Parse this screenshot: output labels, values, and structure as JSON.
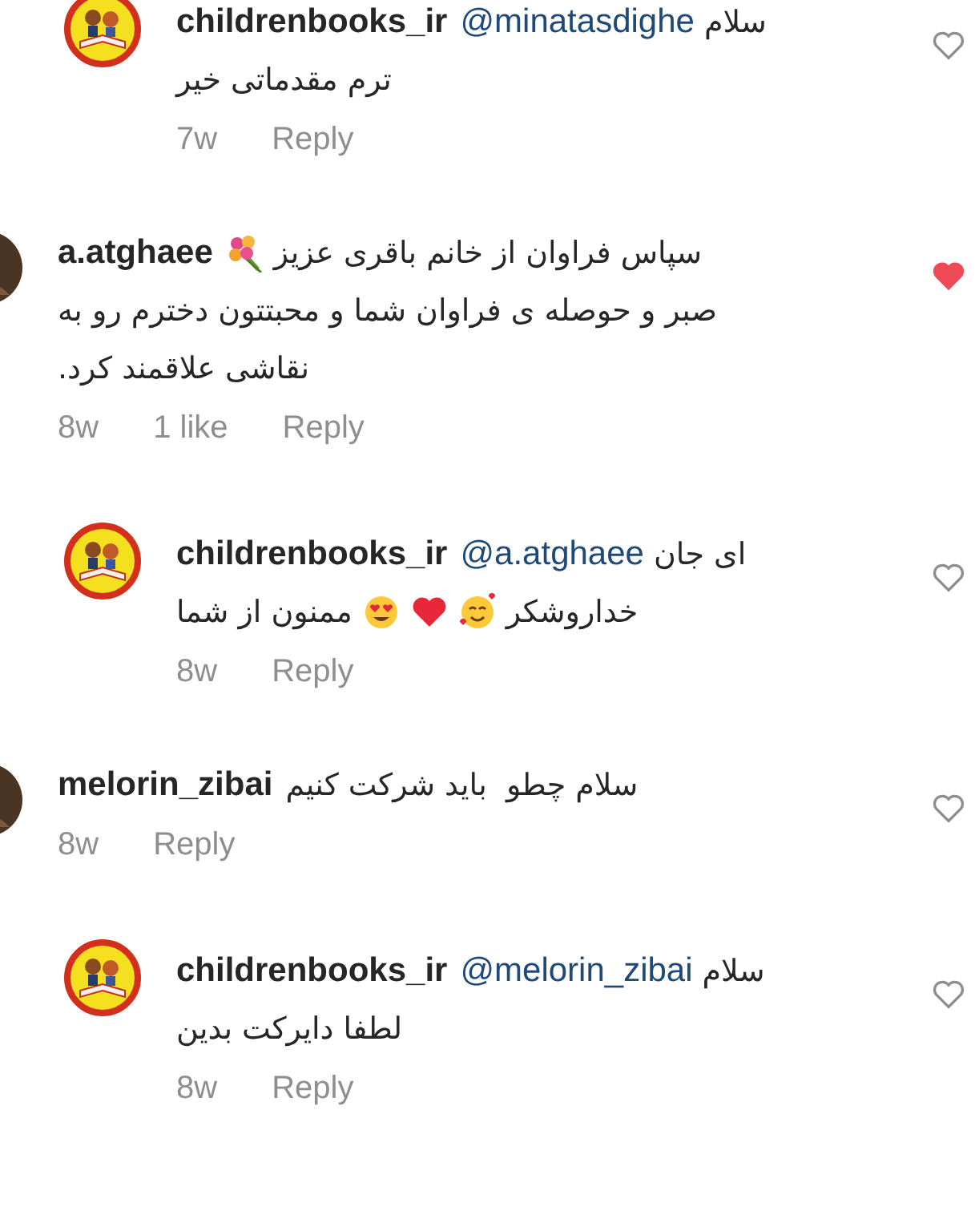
{
  "comments": [
    {
      "kind": "reply",
      "username": "childrenbooks_ir",
      "mention": "@minatasdighe",
      "lines": [
        [
          {
            "text": "سلام"
          }
        ],
        [
          {
            "text": "ترم مقدماتی خیر"
          }
        ]
      ],
      "time": "7w",
      "reply_label": "Reply",
      "liked": false
    },
    {
      "kind": "comment",
      "username": "a.atghaee",
      "lines": [
        [
          {
            "text": "سپاس فراوان از خانم باقری عزیز"
          },
          {
            "kind": "bouquet"
          }
        ],
        [
          {
            "text": "صبر و حوصله ی فراوان شما و محبتتون دخترم رو به"
          }
        ],
        [
          {
            "text": "نقاشی علاقمند کرد."
          }
        ]
      ],
      "time": "8w",
      "likes": "1 like",
      "reply_label": "Reply",
      "liked": true
    },
    {
      "kind": "reply",
      "username": "childrenbooks_ir",
      "mention": "@a.atghaee",
      "lines": [
        [
          {
            "text": "ای جان"
          }
        ],
        [
          {
            "text": "خداروشکر"
          },
          {
            "kind": "smiling-hearts"
          },
          {
            "kind": "red-heart"
          },
          {
            "kind": "heart-eyes"
          },
          {
            "text": "ممنون از شما"
          }
        ]
      ],
      "time": "8w",
      "reply_label": "Reply",
      "liked": false
    },
    {
      "kind": "comment",
      "username": "melorin_zibai",
      "lines": [
        [
          {
            "text": "سلام چطو  باید شرکت کنیم"
          }
        ]
      ],
      "time": "8w",
      "reply_label": "Reply",
      "liked": false
    },
    {
      "kind": "reply",
      "username": "childrenbooks_ir",
      "mention": "@melorin_zibai",
      "lines": [
        [
          {
            "text": "سلام"
          }
        ],
        [
          {
            "text": "لطفا دایرکت بدین"
          }
        ]
      ],
      "time": "8w",
      "reply_label": "Reply",
      "liked": false
    }
  ]
}
